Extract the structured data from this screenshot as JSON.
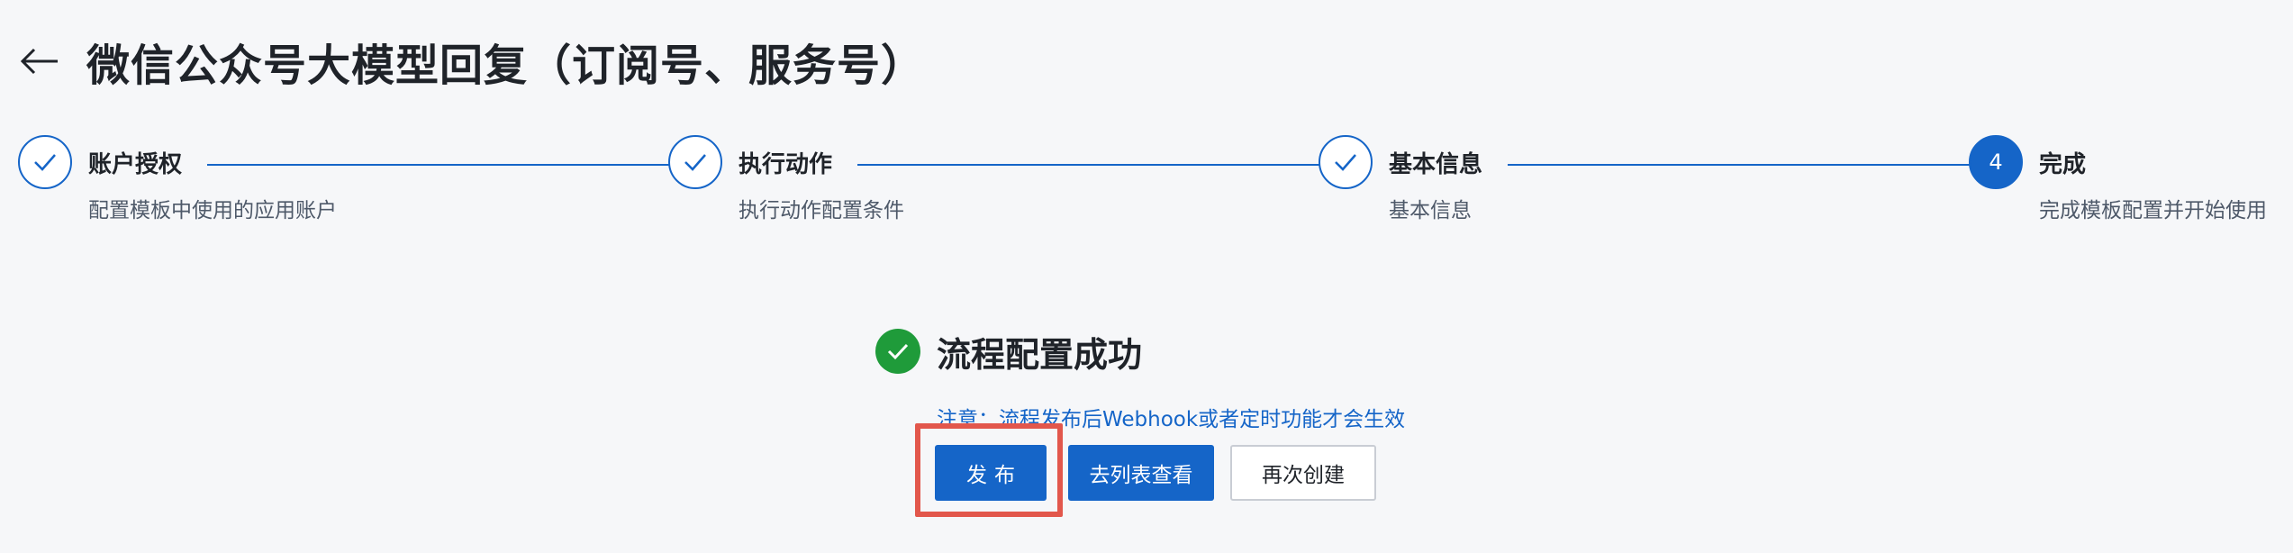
{
  "header": {
    "back_icon": "arrow-left-icon",
    "title": "微信公众号大模型回复（订阅号、服务号）"
  },
  "steps": [
    {
      "title": "账户授权",
      "desc": "配置模板中使用的应用账户",
      "status": "done",
      "icon": "check-icon"
    },
    {
      "title": "执行动作",
      "desc": "执行动作配置条件",
      "status": "done",
      "icon": "check-icon"
    },
    {
      "title": "基本信息",
      "desc": "基本信息",
      "status": "done",
      "icon": "check-icon"
    },
    {
      "title": "完成",
      "desc": "完成模板配置并开始使用",
      "status": "active",
      "number": "4"
    }
  ],
  "result": {
    "icon": "success-check-icon",
    "title": "流程配置成功",
    "note": "注意：流程发布后Webhook或者定时功能才会生效"
  },
  "actions": {
    "publish_label": "发布",
    "list_label": "去列表查看",
    "recreate_label": "再次创建"
  },
  "colors": {
    "accent": "#1565c8",
    "success": "#1f9b3a",
    "highlight": "#e2574c",
    "background": "#f6f7f9"
  }
}
